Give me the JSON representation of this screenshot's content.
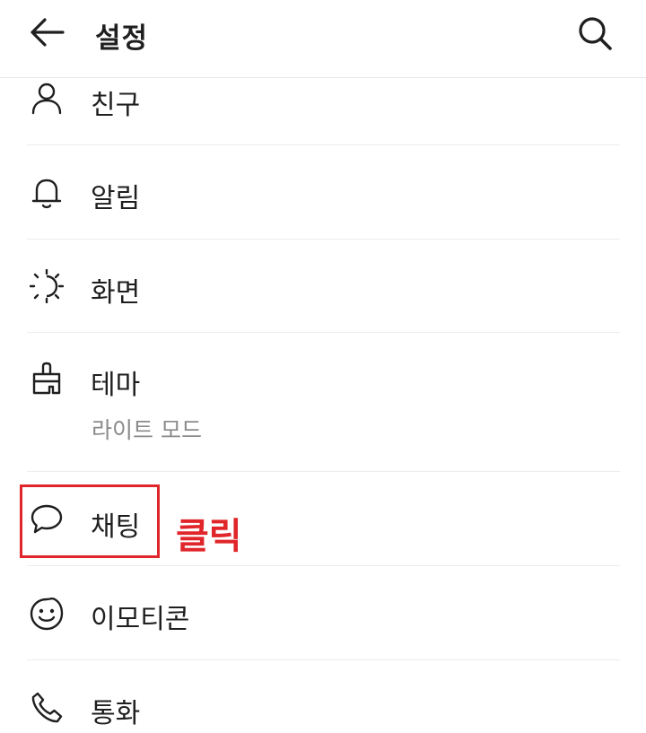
{
  "header": {
    "title": "설정",
    "back_icon": "arrow-left-icon",
    "search_icon": "search-icon"
  },
  "items": [
    {
      "label": "친구",
      "icon": "person-icon"
    },
    {
      "label": "알림",
      "icon": "bell-icon"
    },
    {
      "label": "화면",
      "icon": "brightness-icon"
    },
    {
      "label": "테마",
      "sublabel": "라이트 모드",
      "icon": "paint-brush-icon"
    },
    {
      "label": "채팅",
      "icon": "chat-bubble-icon"
    },
    {
      "label": "이모티콘",
      "icon": "smiley-icon"
    },
    {
      "label": "통화",
      "icon": "phone-icon"
    }
  ],
  "annotation": {
    "text": "클릭",
    "color": "#e0262a"
  }
}
